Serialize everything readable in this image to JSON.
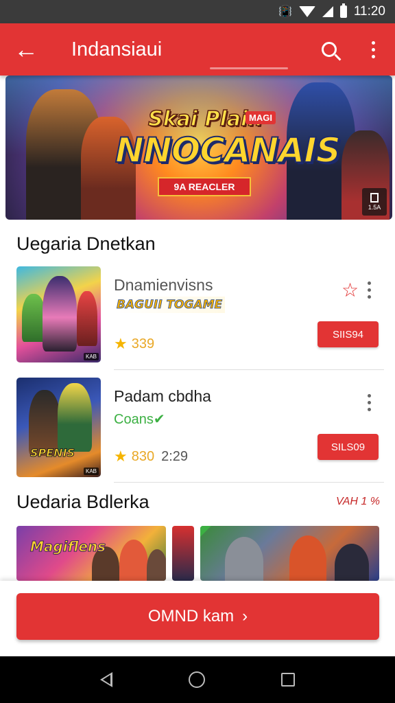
{
  "status_bar": {
    "time": "11:20",
    "icons": [
      "vibrate-icon",
      "wifi-icon",
      "signal-icon",
      "battery-icon"
    ]
  },
  "app_bar": {
    "title": "Indansiaui",
    "back_icon": "arrow-left-icon",
    "search_icon": "search-icon",
    "menu_icon": "more-vert-icon",
    "color": "#e23434"
  },
  "banner": {
    "title_line1": "Skai Plain",
    "tag": "MAGI",
    "title_line2": "NNOCANAIS",
    "ribbon": "9A REACLER",
    "badge": "1.5A"
  },
  "section1": {
    "title": "Uegaria Dnetkan"
  },
  "items": [
    {
      "title": "Dnamienvisns",
      "logo": "BAGUII TOGAME",
      "rating": "339",
      "price": "SIIS94",
      "thumb_corner": "KAB",
      "favorite_icon": "star-outline-icon",
      "menu_icon": "more-vert-icon"
    },
    {
      "title": "Padam cbdha",
      "subtitle": "Coans✔",
      "rating": "830",
      "time": "2:29",
      "price": "SILS09",
      "thumb_label": "SPENIS",
      "thumb_corner": "KAB",
      "menu_icon": "more-vert-icon"
    }
  ],
  "section2": {
    "title": "Uedaria Bdlerka",
    "view_all": "VAH 1 %"
  },
  "carousel": {
    "card1_logo": "Magiflens"
  },
  "cta": {
    "label": "OMND kam",
    "chevron": "›"
  },
  "nav": {
    "icons": [
      "nav-back-icon",
      "nav-home-icon",
      "nav-recent-icon"
    ]
  }
}
